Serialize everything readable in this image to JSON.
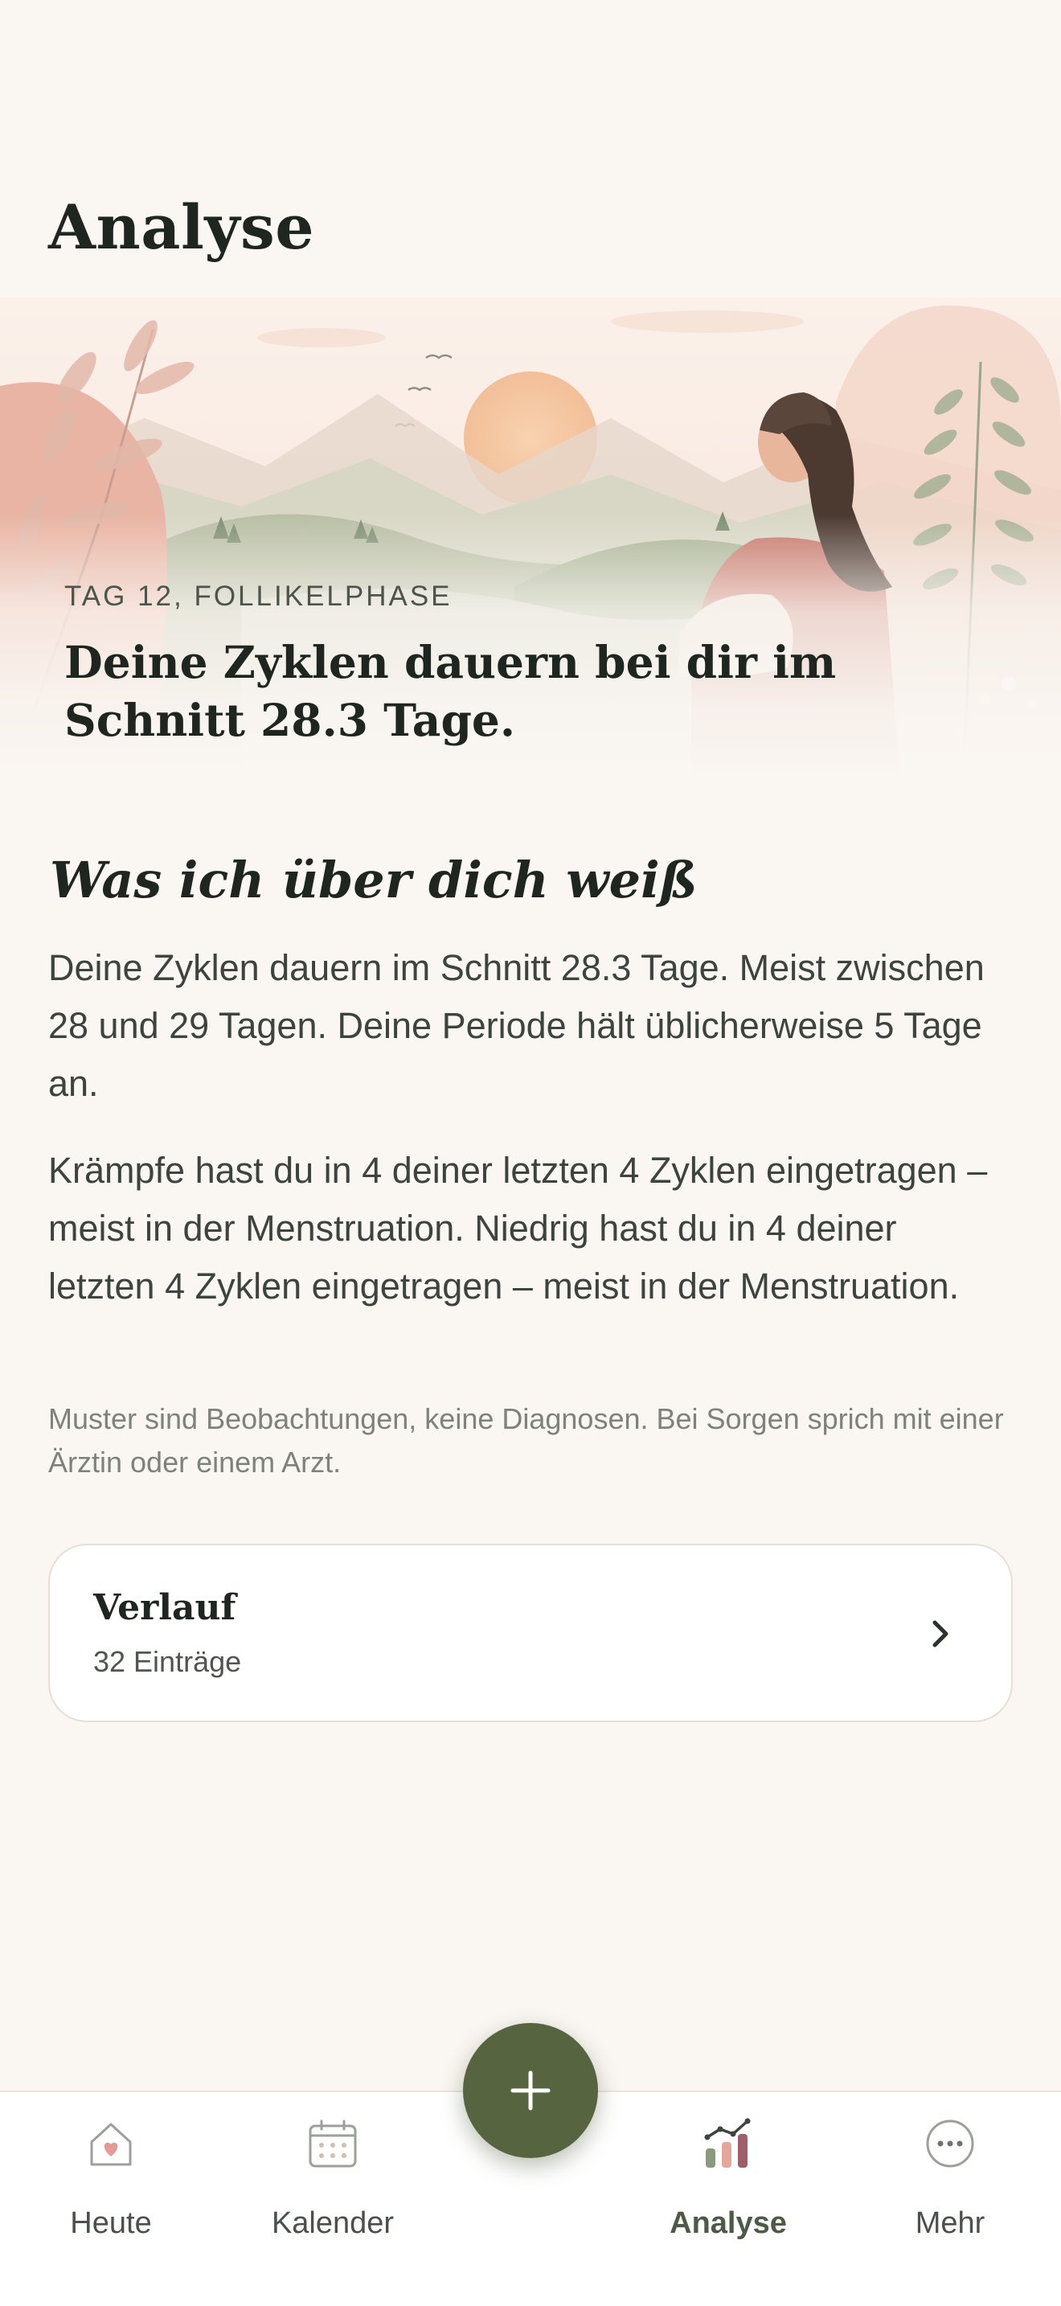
{
  "header": {
    "title": "Analyse"
  },
  "hero": {
    "eyebrow": "TAG 12, FOLLIKELPHASE",
    "headline": "Deine Zyklen dauern bei dir im Schnitt 28.3 Tage."
  },
  "insights": {
    "title": "Was ich über dich weiß",
    "paragraph1": "Deine Zyklen dauern im Schnitt 28.3 Tage. Meist zwischen 28 und 29 Tagen. Deine Periode hält üblicherweise 5 Tage an.",
    "paragraph2": "Krämpfe hast du in 4 deiner letzten 4 Zyklen eingetragen – meist in der Menstruation. Niedrig hast du in 4 deiner letzten 4 Zyklen eingetragen – meist in der Menstruation.",
    "disclaimer": "Muster sind Beobachtungen, keine Diagnosen. Bei Sorgen sprich mit einer Ärztin oder einem Arzt."
  },
  "history_card": {
    "title": "Verlauf",
    "subtitle": "32 Einträge"
  },
  "tabbar": {
    "tabs": [
      {
        "label": "Heute",
        "icon": "home-heart-icon",
        "active": false
      },
      {
        "label": "Kalender",
        "icon": "calendar-icon",
        "active": false
      },
      {
        "label": "Analyse",
        "icon": "chart-icon",
        "active": true
      },
      {
        "label": "Mehr",
        "icon": "more-icon",
        "active": false
      }
    ],
    "fab_icon": "plus-icon"
  },
  "colors": {
    "background": "#faf6f2",
    "accent": "#56653f",
    "text": "#1f2620",
    "muted": "#7d827b"
  }
}
